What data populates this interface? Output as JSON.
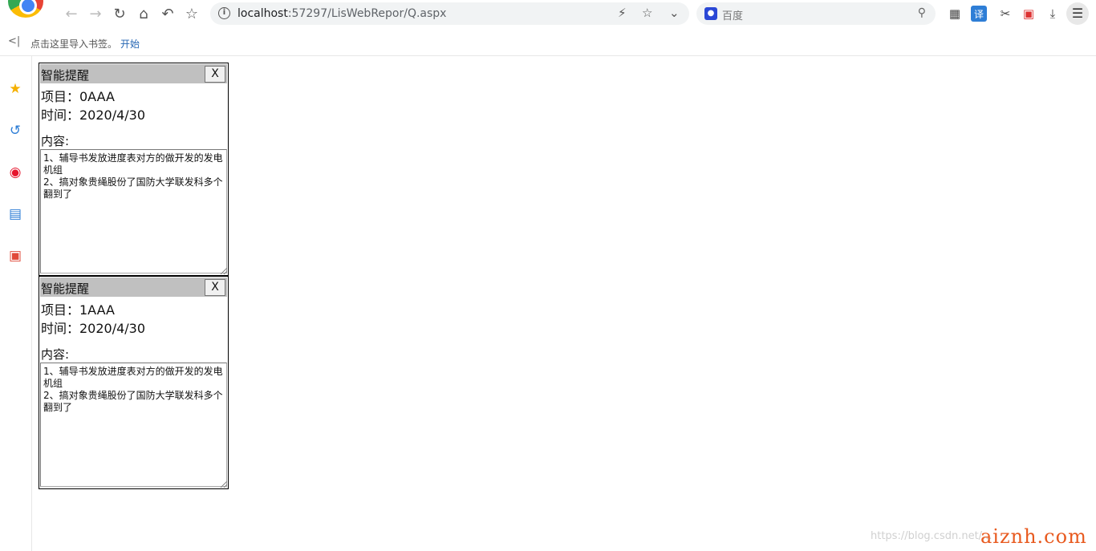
{
  "browser": {
    "address": {
      "host": "localhost",
      "path": ":57297/LisWebRepor/Q.aspx"
    },
    "search": {
      "placeholder": "百度"
    },
    "bookmarks": {
      "hint": "点击这里导入书签。",
      "start_link": "开始"
    }
  },
  "sidebar": {
    "items": [
      "favorites-icon",
      "history-icon",
      "weibo-icon",
      "card-icon",
      "pdf-icon"
    ]
  },
  "panels": [
    {
      "title": "智能提醒",
      "close_label": "X",
      "project": "项目：0AAA",
      "time": "时间：2020/4/30",
      "content_label": "内容:",
      "content": "1、辅导书发放进度表对方的做开发的发电机组\n2、搞对象贵绳股份了国防大学联发科多个翻到了"
    },
    {
      "title": "智能提醒",
      "close_label": "X",
      "project": "项目：1AAA",
      "time": "时间：2020/4/30",
      "content_label": "内容:",
      "content": "1、辅导书发放进度表对方的做开发的发电机组\n2、搞对象贵绳股份了国防大学联发科多个翻到了"
    }
  ],
  "watermark": {
    "url": "https://blog.csdn.net/...",
    "brand": "aiznh.com"
  }
}
